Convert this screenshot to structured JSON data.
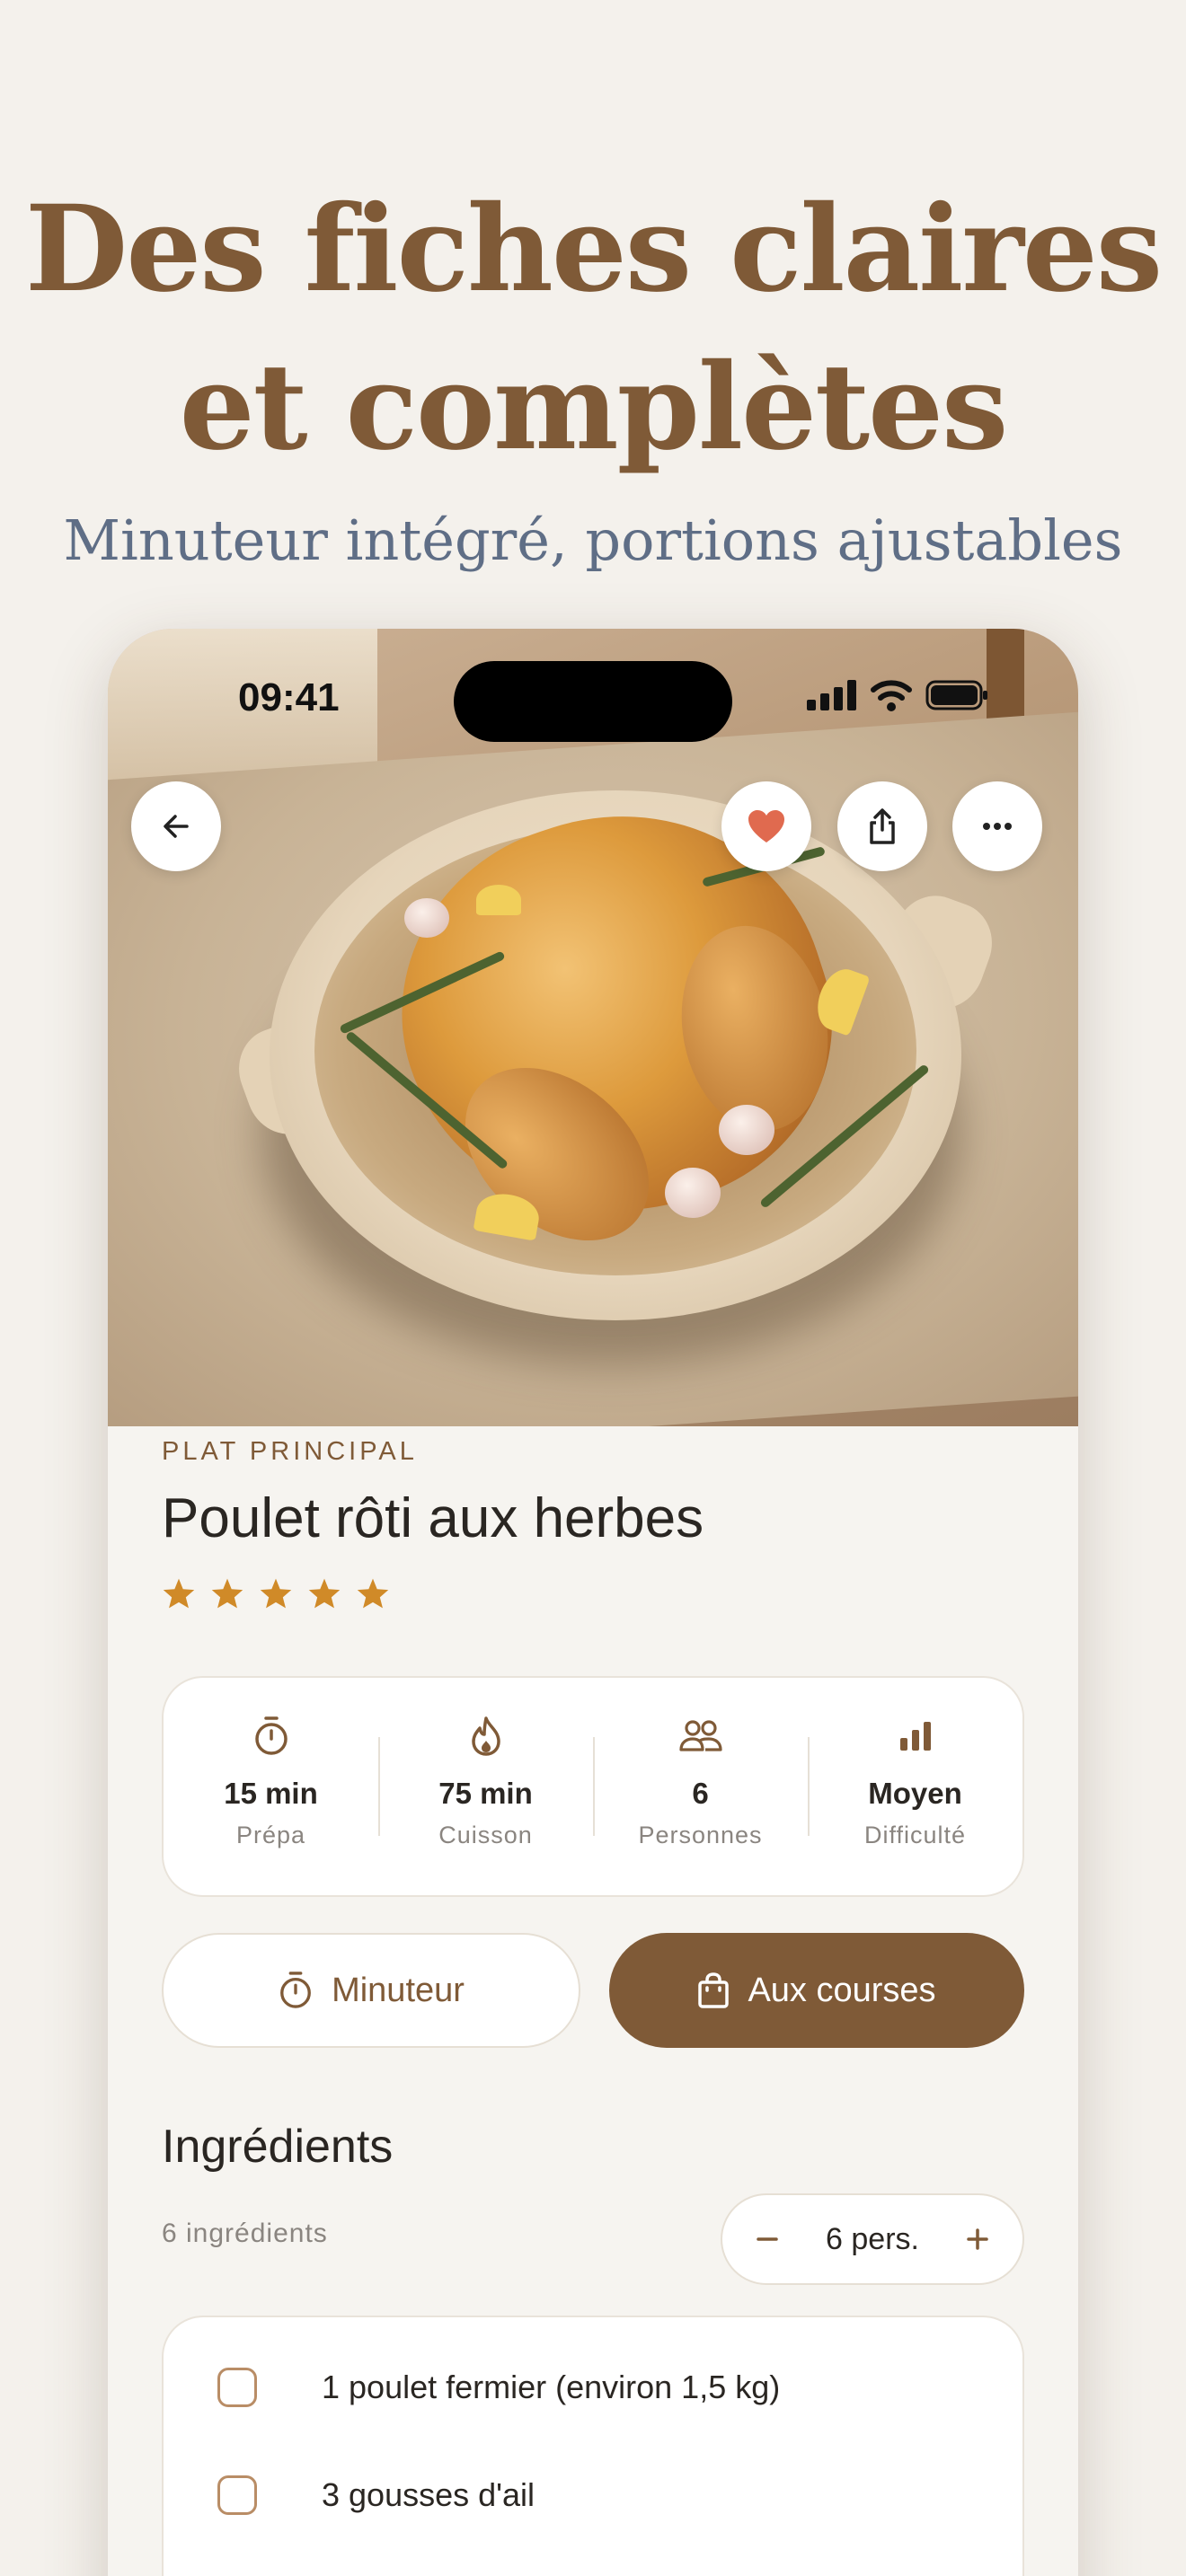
{
  "marketing": {
    "headline_line1": "Des fiches claires",
    "headline_line2": "et complètes",
    "subheadline": "Minuteur intégré, portions ajustables"
  },
  "status_bar": {
    "time": "09:41"
  },
  "recipe": {
    "category": "PLAT PRINCIPAL",
    "title": "Poulet rôti aux herbes",
    "rating": 5,
    "stats": [
      {
        "icon": "timer-icon",
        "value": "15 min",
        "label": "Prépa"
      },
      {
        "icon": "flame-icon",
        "value": "75 min",
        "label": "Cuisson"
      },
      {
        "icon": "people-icon",
        "value": "6",
        "label": "Personnes"
      },
      {
        "icon": "bars-icon",
        "value": "Moyen",
        "label": "Difficulté"
      }
    ],
    "actions": {
      "timer_label": "Minuteur",
      "shopping_label": "Aux courses"
    }
  },
  "ingredients": {
    "section_title": "Ingrédients",
    "count_label": "6 ingrédients",
    "servings_label": "6 pers.",
    "items": [
      "1 poulet fermier (environ 1,5 kg)",
      "3 gousses d'ail"
    ]
  },
  "colors": {
    "accent": "#7f5a37",
    "star": "#d08a28",
    "heart": "#e06a4f",
    "subhead": "#5f6e86"
  }
}
